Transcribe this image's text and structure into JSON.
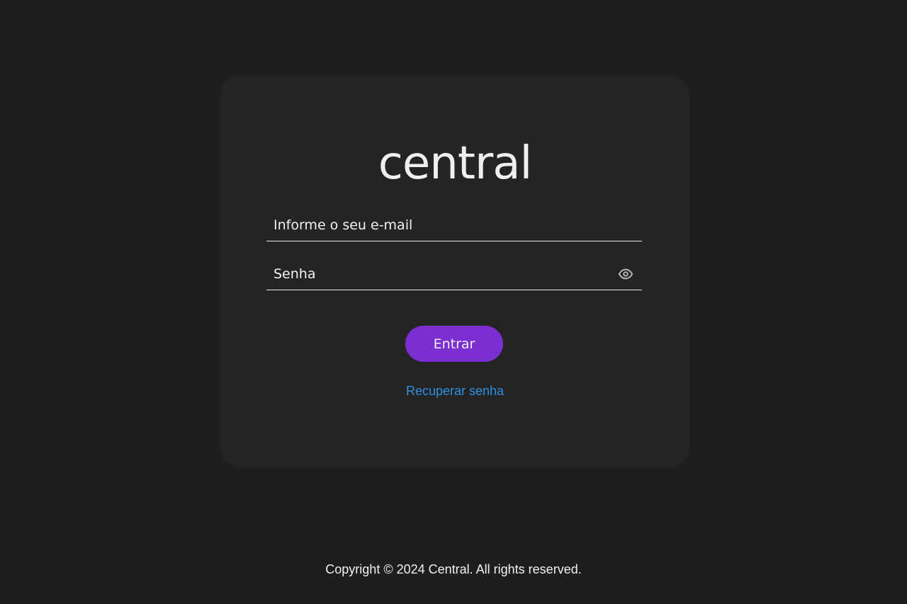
{
  "brand": {
    "logo_text": "central"
  },
  "form": {
    "email_placeholder": "Informe o seu e-mail",
    "email_value": "",
    "password_placeholder": "Senha",
    "password_value": "",
    "password_toggle_icon": "eye-icon",
    "submit_label": "Entrar",
    "recover_label": "Recuperar senha"
  },
  "footer": {
    "copyright": "Copyright © 2024 Central. All rights reserved."
  },
  "colors": {
    "background": "#1e1e1e",
    "card": "#242424",
    "accent": "#7b2fd1",
    "link": "#2f8fe0"
  }
}
